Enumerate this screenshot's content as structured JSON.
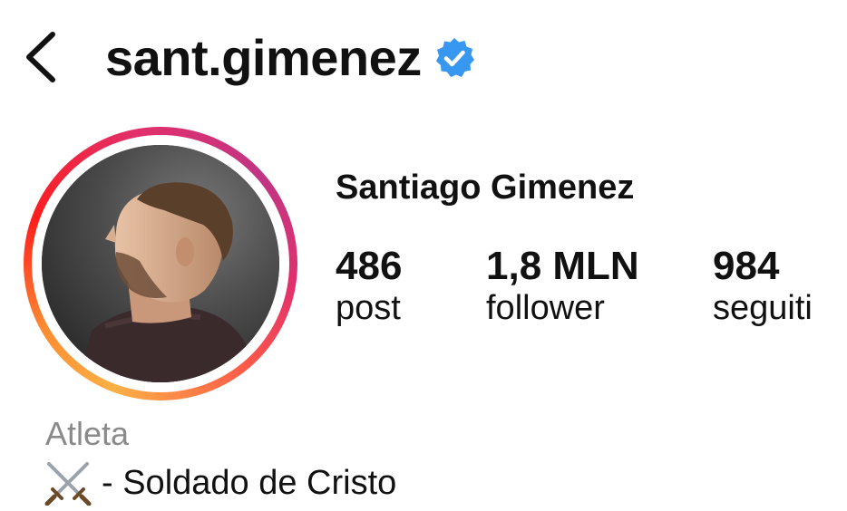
{
  "header": {
    "username": "sant.gimenez",
    "verified_color": "#3897f0"
  },
  "profile": {
    "full_name": "Santiago Gimenez",
    "stats": [
      {
        "value": "486",
        "label": "post"
      },
      {
        "value": "1,8 MLN",
        "label": "follower"
      },
      {
        "value": "984",
        "label": "seguiti"
      }
    ],
    "category": "Atleta",
    "bio": "- Soldado de Cristo",
    "bio_icon": "crossed-swords-icon"
  }
}
